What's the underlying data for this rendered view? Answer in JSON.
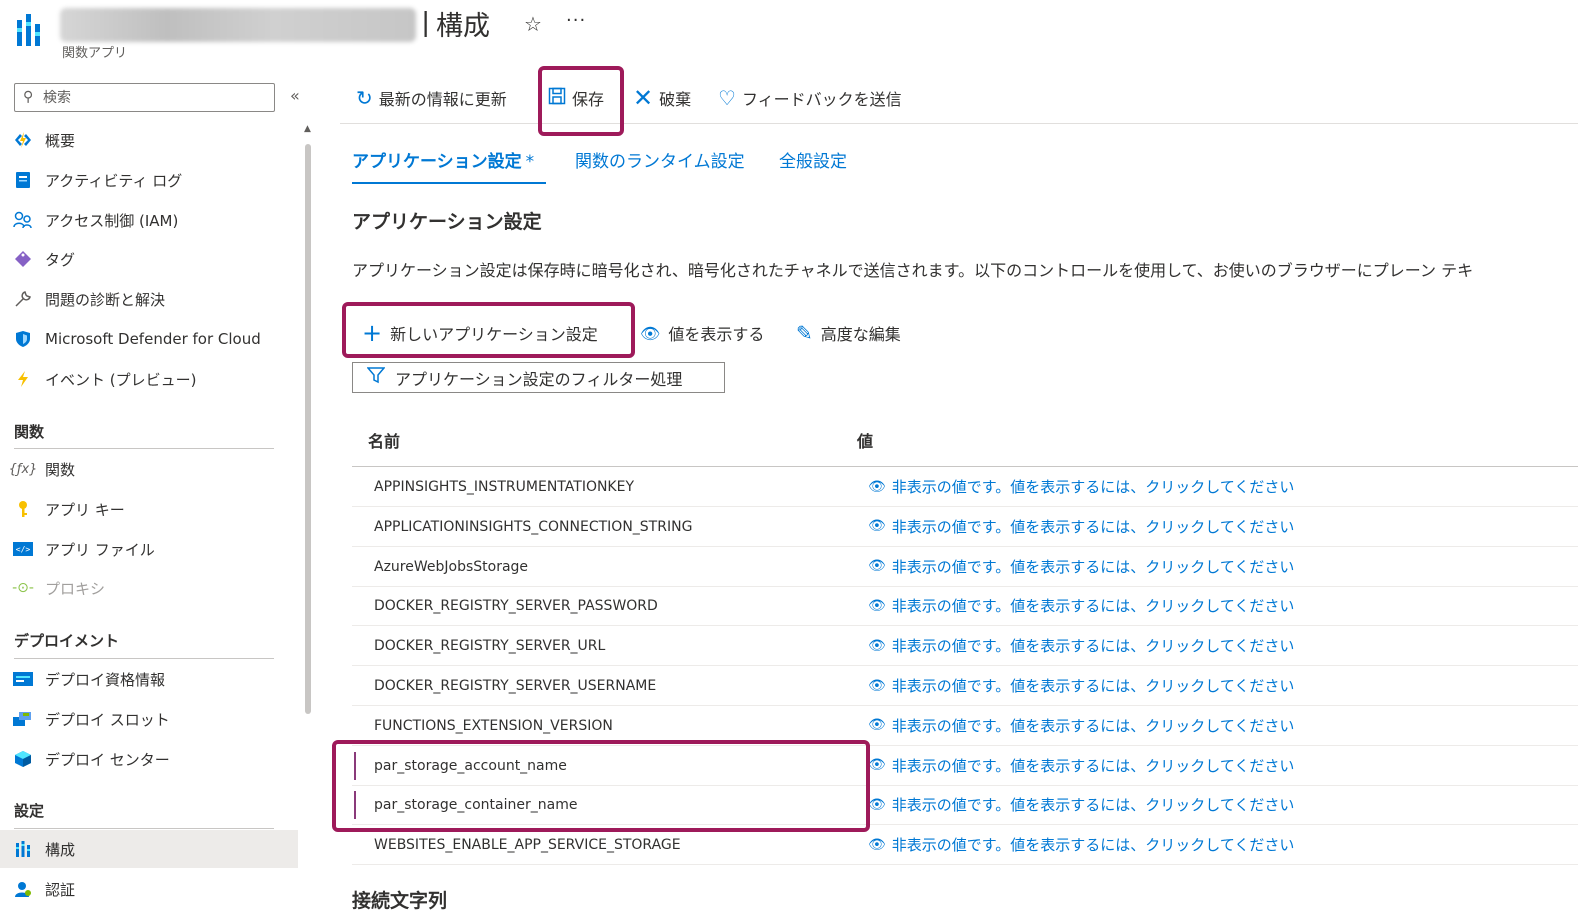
{
  "header": {
    "title_separator": "|",
    "page_title": "構成",
    "subtitle": "関数アプリ",
    "favorite_icon": "star-icon",
    "more_icon": "ellipsis-icon"
  },
  "sidebar": {
    "search_placeholder": "検索",
    "collapse_glyph": "«",
    "items_top": [
      {
        "label": "概要",
        "icon": "function-app-icon"
      },
      {
        "label": "アクティビティ ログ",
        "icon": "activity-log-icon"
      },
      {
        "label": "アクセス制御 (IAM)",
        "icon": "iam-icon"
      },
      {
        "label": "タグ",
        "icon": "tag-icon"
      },
      {
        "label": "問題の診断と解決",
        "icon": "wrench-icon"
      },
      {
        "label": "Microsoft Defender for Cloud",
        "icon": "shield-icon"
      },
      {
        "label": "イベント (プレビュー)",
        "icon": "lightning-icon"
      }
    ],
    "sections": [
      {
        "title": "関数",
        "items": [
          {
            "label": "関数",
            "icon": "function-icon",
            "disabled": false
          },
          {
            "label": "アプリ キー",
            "icon": "key-icon",
            "disabled": false
          },
          {
            "label": "アプリ ファイル",
            "icon": "code-file-icon",
            "disabled": false
          },
          {
            "label": "プロキシ",
            "icon": "proxy-icon",
            "disabled": true
          }
        ]
      },
      {
        "title": "デプロイメント",
        "items": [
          {
            "label": "デプロイ資格情報",
            "icon": "credentials-icon"
          },
          {
            "label": "デプロイ スロット",
            "icon": "slots-icon"
          },
          {
            "label": "デプロイ センター",
            "icon": "cube-icon"
          }
        ]
      },
      {
        "title": "設定",
        "items": [
          {
            "label": "構成",
            "icon": "configuration-icon",
            "selected": true
          },
          {
            "label": "認証",
            "icon": "person-icon"
          }
        ]
      }
    ]
  },
  "toolbar": {
    "refresh": "最新の情報に更新",
    "save": "保存",
    "discard": "破棄",
    "feedback": "フィードバックを送信"
  },
  "tabs": [
    {
      "label": "アプリケーション設定",
      "modified_marker": "*",
      "active": true
    },
    {
      "label": "関数のランタイム設定",
      "active": false
    },
    {
      "label": "全般設定",
      "active": false
    }
  ],
  "section": {
    "title": "アプリケーション設定",
    "description": "アプリケーション設定は保存時に暗号化され、暗号化されたチャネルで送信されます。以下のコントロールを使用して、お使いのブラウザーにプレーン テキ"
  },
  "commands": {
    "new_setting": "新しいアプリケーション設定",
    "show_values": "値を表示する",
    "advanced_edit": "高度な編集",
    "filter": "アプリケーション設定のフィルター処理"
  },
  "table": {
    "headers": {
      "name": "名前",
      "value": "値"
    },
    "hidden_value_text": "非表示の値です。値を表示するには、クリックしてください",
    "rows": [
      {
        "name": "APPINSIGHTS_INSTRUMENTATIONKEY"
      },
      {
        "name": "APPLICATIONINSIGHTS_CONNECTION_STRING"
      },
      {
        "name": "AzureWebJobsStorage"
      },
      {
        "name": "DOCKER_REGISTRY_SERVER_PASSWORD"
      },
      {
        "name": "DOCKER_REGISTRY_SERVER_URL"
      },
      {
        "name": "DOCKER_REGISTRY_SERVER_USERNAME"
      },
      {
        "name": "FUNCTIONS_EXTENSION_VERSION"
      },
      {
        "name": "par_storage_account_name",
        "modified": true
      },
      {
        "name": "par_storage_container_name",
        "modified": true
      },
      {
        "name": "WEBSITES_ENABLE_APP_SERVICE_STORAGE"
      }
    ]
  },
  "connection_strings": {
    "title": "接続文字列"
  },
  "colors": {
    "accent": "#0078d4",
    "highlight": "#9e1a5a"
  }
}
